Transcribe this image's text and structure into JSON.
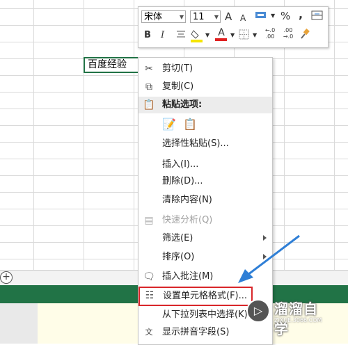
{
  "cell": {
    "value": "百度经验"
  },
  "mini_toolbar": {
    "font_name": "宋体",
    "font_size": "11",
    "grow_font": "A",
    "shrink_font": "A",
    "percent": "%",
    "comma": ",",
    "bold": "B",
    "italic": "I",
    "font_color": "A",
    "increase_decimal": "←.0 .00",
    "decrease_decimal": ".00 →.0"
  },
  "context_menu": {
    "items": [
      {
        "label": "剪切(T)",
        "icon": "scissors-icon"
      },
      {
        "label": "复制(C)",
        "icon": "copy-icon"
      },
      {
        "label": "粘贴选项:",
        "icon": "clipboard-icon"
      },
      {
        "label": "",
        "icon": "paste-options-icon"
      },
      {
        "label": "选择性粘贴(S)...",
        "icon": ""
      },
      {
        "label": "插入(I)...",
        "icon": ""
      },
      {
        "label": "删除(D)...",
        "icon": ""
      },
      {
        "label": "清除内容(N)",
        "icon": ""
      },
      {
        "label": "快速分析(Q)",
        "icon": "quick-analysis-icon"
      },
      {
        "label": "筛选(E)",
        "icon": ""
      },
      {
        "label": "排序(O)",
        "icon": ""
      },
      {
        "label": "插入批注(M)",
        "icon": "comment-icon"
      },
      {
        "label": "设置单元格格式(F)...",
        "icon": "format-cells-icon"
      },
      {
        "label": "从下拉列表中选择(K)...",
        "icon": ""
      },
      {
        "label": "显示拼音字段(S)",
        "icon": "pinyin-icon"
      }
    ]
  },
  "sheet_bar": {
    "add_sheet": "+"
  },
  "watermark": {
    "title": "溜溜自学",
    "sub": "ZIXUE.3066.COM"
  },
  "colors": {
    "excel_green": "#217346",
    "highlight_red": "#d9262a",
    "arrow_blue": "#2f7fd6"
  }
}
